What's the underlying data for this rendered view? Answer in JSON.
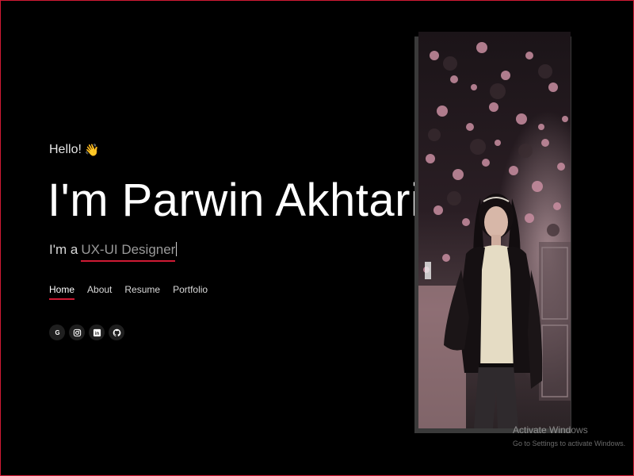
{
  "hero": {
    "greeting": "Hello!",
    "greeting_emoji": "👋",
    "name": "I'm Parwin Akhtari",
    "role_prefix": "I'm a",
    "role_typed": "UX-UI Designer"
  },
  "nav": {
    "items": [
      {
        "label": "Home",
        "active": true
      },
      {
        "label": "About",
        "active": false
      },
      {
        "label": "Resume",
        "active": false
      },
      {
        "label": "Portfolio",
        "active": false
      }
    ]
  },
  "social": {
    "icons": [
      "google-icon",
      "instagram-icon",
      "linkedin-icon",
      "github-icon"
    ],
    "google_letter": "G",
    "linkedin_letters": "in"
  },
  "watermark": {
    "title": "Activate Windows",
    "subtitle": "Go to Settings to activate Windows."
  },
  "colors": {
    "background": "#000000",
    "accent": "#d01a34",
    "text": "#ffffff",
    "muted_text": "#9a9a9a",
    "icon_bg": "#1f1f1f"
  }
}
